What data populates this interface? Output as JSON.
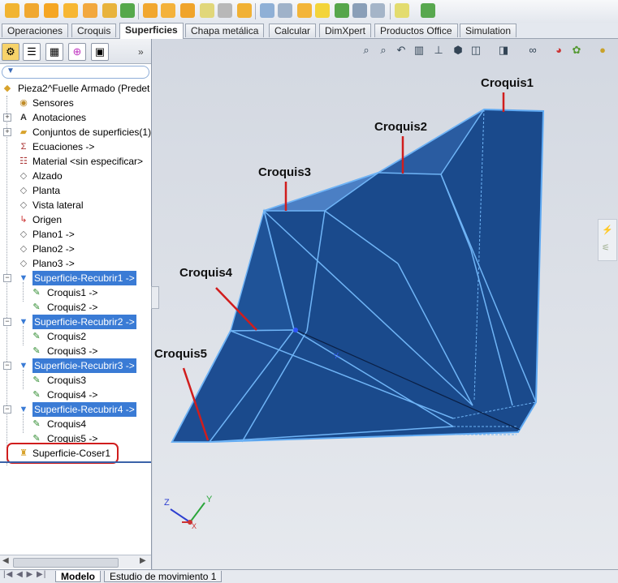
{
  "command_tabs": [
    {
      "label": "Operaciones",
      "active": false
    },
    {
      "label": "Croquis",
      "active": false
    },
    {
      "label": "Superficies",
      "active": true
    },
    {
      "label": "Chapa metálica",
      "active": false
    },
    {
      "label": "Calcular",
      "active": false
    },
    {
      "label": "DimXpert",
      "active": false
    },
    {
      "label": "Productos Office",
      "active": false
    },
    {
      "label": "Simulation",
      "active": false
    }
  ],
  "tree": {
    "root": "Pieza2^Fuelle Armado  (Predet",
    "items": [
      {
        "label": "Sensores"
      },
      {
        "label": "Anotaciones"
      },
      {
        "label": "Conjuntos de superficies(1)"
      },
      {
        "label": "Ecuaciones ->"
      },
      {
        "label": "Material <sin especificar>"
      },
      {
        "label": "Alzado"
      },
      {
        "label": "Planta"
      },
      {
        "label": "Vista lateral"
      },
      {
        "label": "Origen"
      },
      {
        "label": "Plano1 ->"
      },
      {
        "label": "Plano2 ->"
      },
      {
        "label": "Plano3 ->"
      },
      {
        "label": "Superficie-Recubrir1 ->"
      },
      {
        "label": "Croquis1 ->"
      },
      {
        "label": "Croquis2 ->"
      },
      {
        "label": "Superficie-Recubrir2 ->"
      },
      {
        "label": "Croquis2"
      },
      {
        "label": "Croquis3 ->"
      },
      {
        "label": "Superficie-Recubrir3 ->"
      },
      {
        "label": "Croquis3"
      },
      {
        "label": "Croquis4 ->"
      },
      {
        "label": "Superficie-Recubrir4 ->"
      },
      {
        "label": "Croquis4"
      },
      {
        "label": "Croquis5 ->"
      },
      {
        "label": "Superficie-Coser1"
      }
    ]
  },
  "bottom_tabs": [
    {
      "label": "Modelo",
      "active": true
    },
    {
      "label": "Estudio de movimiento 1",
      "active": false
    }
  ],
  "annotations": {
    "c1": "Croquis1",
    "c2": "Croquis2",
    "c3": "Croquis3",
    "c4": "Croquis4",
    "c5": "Croquis5"
  },
  "triad": {
    "z": "Z",
    "y": "Y",
    "x": "X"
  },
  "colors": {
    "highlight": "#3a7bd5",
    "model_fill": "#1f4f8f",
    "model_edge": "#5fa9f2",
    "callout_circle": "#d01d1d",
    "leader": "#d01d1d"
  }
}
